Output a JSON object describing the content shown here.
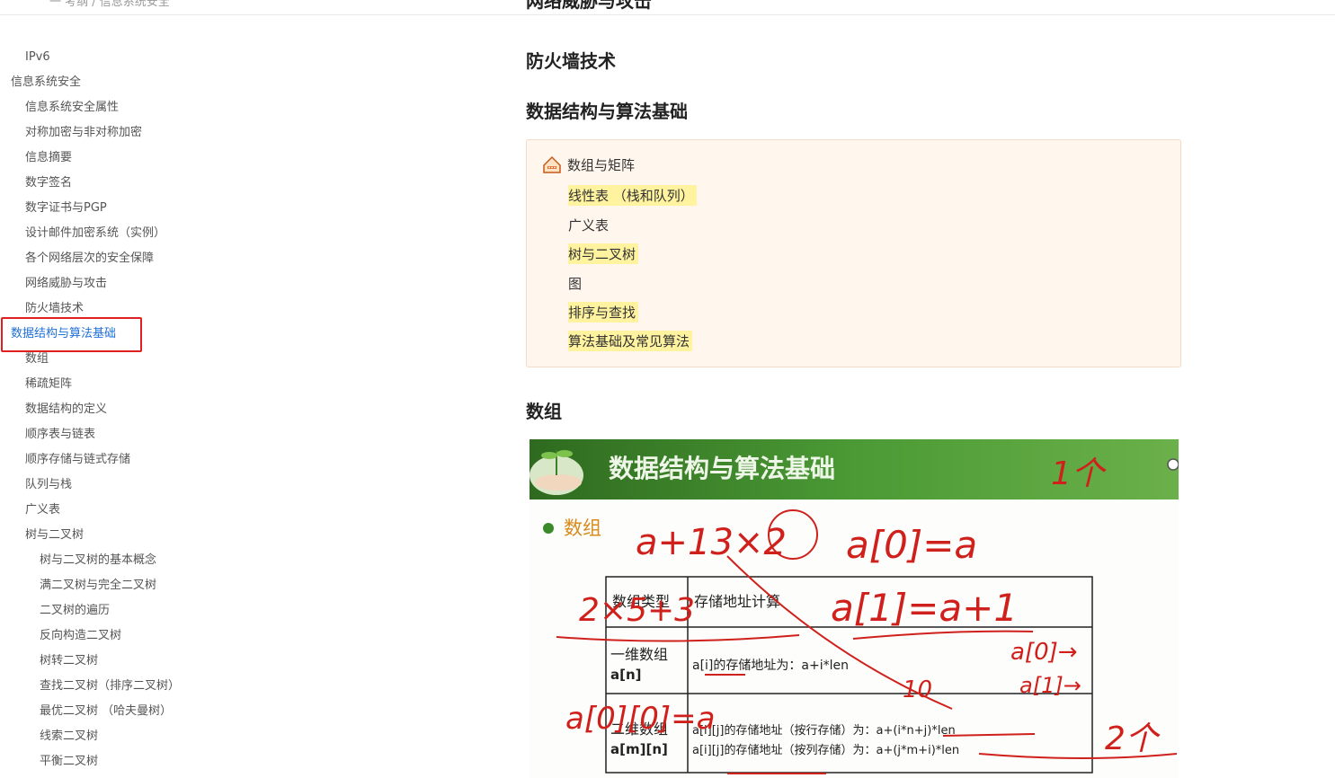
{
  "breadcrumb": "一 考纲 / 信息系统安全",
  "sidebar": {
    "items": [
      {
        "label": "IPv6",
        "level": 1
      },
      {
        "label": "信息系统安全",
        "level": 0
      },
      {
        "label": "信息系统安全属性",
        "level": 1
      },
      {
        "label": "对称加密与非对称加密",
        "level": 1
      },
      {
        "label": "信息摘要",
        "level": 1
      },
      {
        "label": "数字签名",
        "level": 1
      },
      {
        "label": "数字证书与PGP",
        "level": 1
      },
      {
        "label": "设计邮件加密系统（实例）",
        "level": 1
      },
      {
        "label": "各个网络层次的安全保障",
        "level": 1
      },
      {
        "label": "网络威胁与攻击",
        "level": 1
      },
      {
        "label": "防火墙技术",
        "level": 1
      },
      {
        "label": "数据结构与算法基础",
        "level": 0,
        "active": true
      },
      {
        "label": "数组",
        "level": 1
      },
      {
        "label": "稀疏矩阵",
        "level": 1
      },
      {
        "label": "数据结构的定义",
        "level": 1
      },
      {
        "label": "顺序表与链表",
        "level": 1
      },
      {
        "label": "顺序存储与链式存储",
        "level": 1
      },
      {
        "label": "队列与栈",
        "level": 1
      },
      {
        "label": "广义表",
        "level": 1
      },
      {
        "label": "树与二叉树",
        "level": 1
      },
      {
        "label": "树与二叉树的基本概念",
        "level": 2
      },
      {
        "label": "满二叉树与完全二叉树",
        "level": 2
      },
      {
        "label": "二叉树的遍历",
        "level": 2
      },
      {
        "label": "反向构造二叉树",
        "level": 2
      },
      {
        "label": "树转二叉树",
        "level": 2
      },
      {
        "label": "查找二叉树（排序二叉树）",
        "level": 2
      },
      {
        "label": "最优二叉树 （哈夫曼树）",
        "level": 2
      },
      {
        "label": "线索二叉树",
        "level": 2
      },
      {
        "label": "平衡二叉树",
        "level": 2
      }
    ]
  },
  "main": {
    "cut_heading": "网络威胁与攻击",
    "heading_firewall": "防火墙技术",
    "heading_ds": "数据结构与算法基础",
    "mindmap": {
      "root": "数组与矩阵",
      "children": [
        {
          "label": "线性表 （栈和队列）",
          "highlight": true
        },
        {
          "label": "广义表",
          "highlight": false
        },
        {
          "label": "树与二叉树",
          "highlight": true
        },
        {
          "label": "图",
          "highlight": false
        },
        {
          "label": "排序与查找",
          "highlight": true
        },
        {
          "label": "算法基础及常见算法",
          "highlight": true
        }
      ]
    },
    "heading_array": "数组",
    "figure": {
      "banner_title": "数据结构与算法基础",
      "section_label": "数组",
      "table": {
        "headers": [
          "数组类型",
          "存储地址计算"
        ],
        "rows": [
          {
            "type": "一维数组",
            "type_sub": "a[n]",
            "formula_lines": [
              "a[i]的存储地址为：a+i*len"
            ]
          },
          {
            "type": "二维数组",
            "type_sub": "a[m][n]",
            "formula_lines": [
              "a[i][j]的存储地址（按行存储）为：a+(i*n+j)*len",
              "a[i][j]的存储地址（按列存储）为：a+(j*m+i)*len"
            ]
          }
        ]
      },
      "handwriting": [
        "a+13×2",
        "a[0]=a",
        "a[1]=a+1",
        "2×5+3",
        "a[0]→",
        "a[1]→",
        "10",
        "a[0][0]=a",
        "1个",
        "2个"
      ],
      "colors": {
        "banner": "#3f8f2f",
        "ink": "#d0201c"
      }
    }
  },
  "colors": {
    "active": "#1e6fd9",
    "highlight": "#fff3a0",
    "mind_bg": "#fff6ee",
    "mind_border": "#f3dcc7",
    "red_box": "#e02020"
  }
}
